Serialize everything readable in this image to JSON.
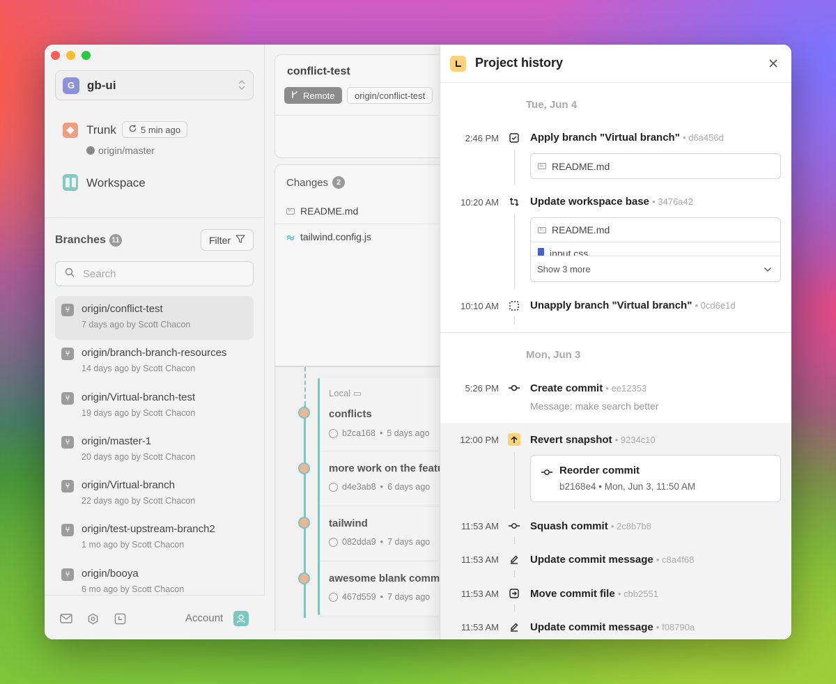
{
  "sidebar": {
    "project": {
      "initial": "G",
      "name": "gb-ui"
    },
    "trunk": {
      "label": "Trunk",
      "badge": "5 min ago",
      "remote": "origin/master"
    },
    "workspace": {
      "label": "Workspace"
    },
    "branches_title": "Branches",
    "branches_count": "11",
    "filter_label": "Filter",
    "search_placeholder": "Search",
    "branches": [
      {
        "name": "origin/conflict-test",
        "meta": "7 days ago by Scott Chacon",
        "selected": true
      },
      {
        "name": "origin/branch-branch-resources",
        "meta": "14 days ago by Scott Chacon"
      },
      {
        "name": "origin/Virtual-branch-test",
        "meta": "19 days ago by Scott Chacon"
      },
      {
        "name": "origin/master-1",
        "meta": "20 days ago by Scott Chacon"
      },
      {
        "name": "origin/Virtual-branch",
        "meta": "22 days ago by Scott Chacon"
      },
      {
        "name": "origin/test-upstream-branch2",
        "meta": "1 mo ago by Scott Chacon"
      },
      {
        "name": "origin/booya",
        "meta": "6 mo ago by Scott Chacon"
      }
    ],
    "footer": {
      "account_label": "Account"
    }
  },
  "branch_panel": {
    "title": "conflict-test",
    "remote_badge": "Remote",
    "origin_badge": "origin/conflict-test",
    "changes_label": "Changes",
    "changes_count": "2",
    "files": [
      "README.md",
      "tailwind.config.js"
    ],
    "local_label": "Local",
    "commits": [
      {
        "title": "conflicts",
        "sha": "b2ca168",
        "age": "5 days ago"
      },
      {
        "title": "more work on the featu",
        "sha": "d4e3ab8",
        "age": "6 days ago"
      },
      {
        "title": "tailwind",
        "sha": "082dda9",
        "age": "7 days ago"
      },
      {
        "title": "awesome blank comm",
        "sha": "467d559",
        "age": "7 days ago"
      }
    ]
  },
  "history": {
    "title": "Project history",
    "days": [
      {
        "label": "Tue, Jun 4",
        "entries": [
          {
            "time": "2:46 PM",
            "title": "Apply branch \"Virtual branch\"",
            "sha": "d6a456d",
            "files": [
              "README.md"
            ]
          },
          {
            "time": "10:20 AM",
            "title": "Update workspace base",
            "sha": "3476a42",
            "files": [
              "README.md",
              "input.css"
            ],
            "show_more": "Show 3 more"
          },
          {
            "time": "10:10 AM",
            "title": "Unapply branch \"Virtual branch\"",
            "sha": "0cd6e1d"
          }
        ]
      },
      {
        "label": "Mon, Jun 3",
        "entries": [
          {
            "time": "5:26 PM",
            "title": "Create commit",
            "sha": "ee12353",
            "sub": "Message: make search better"
          },
          {
            "time": "12:00 PM",
            "title": "Revert snapshot",
            "sha": "9234c10",
            "nested": {
              "title": "Reorder commit",
              "meta": "b2168e4 • Mon, Jun 3, 11:50 AM"
            }
          },
          {
            "time": "11:53 AM",
            "title": "Squash commit",
            "sha": "2c8b7b8"
          },
          {
            "time": "11:53 AM",
            "title": "Update commit message",
            "sha": "c8a4f68"
          },
          {
            "time": "11:53 AM",
            "title": "Move commit file",
            "sha": "cbb2551"
          },
          {
            "time": "11:53 AM",
            "title": "Update commit message",
            "sha": "f08790a"
          }
        ]
      }
    ]
  },
  "colors": {
    "accent_teal": "#7fc4be",
    "history_icon": "#fcd37a",
    "project_avatar": "#8c91d8",
    "trunk_icon": "#ee9d7f"
  }
}
